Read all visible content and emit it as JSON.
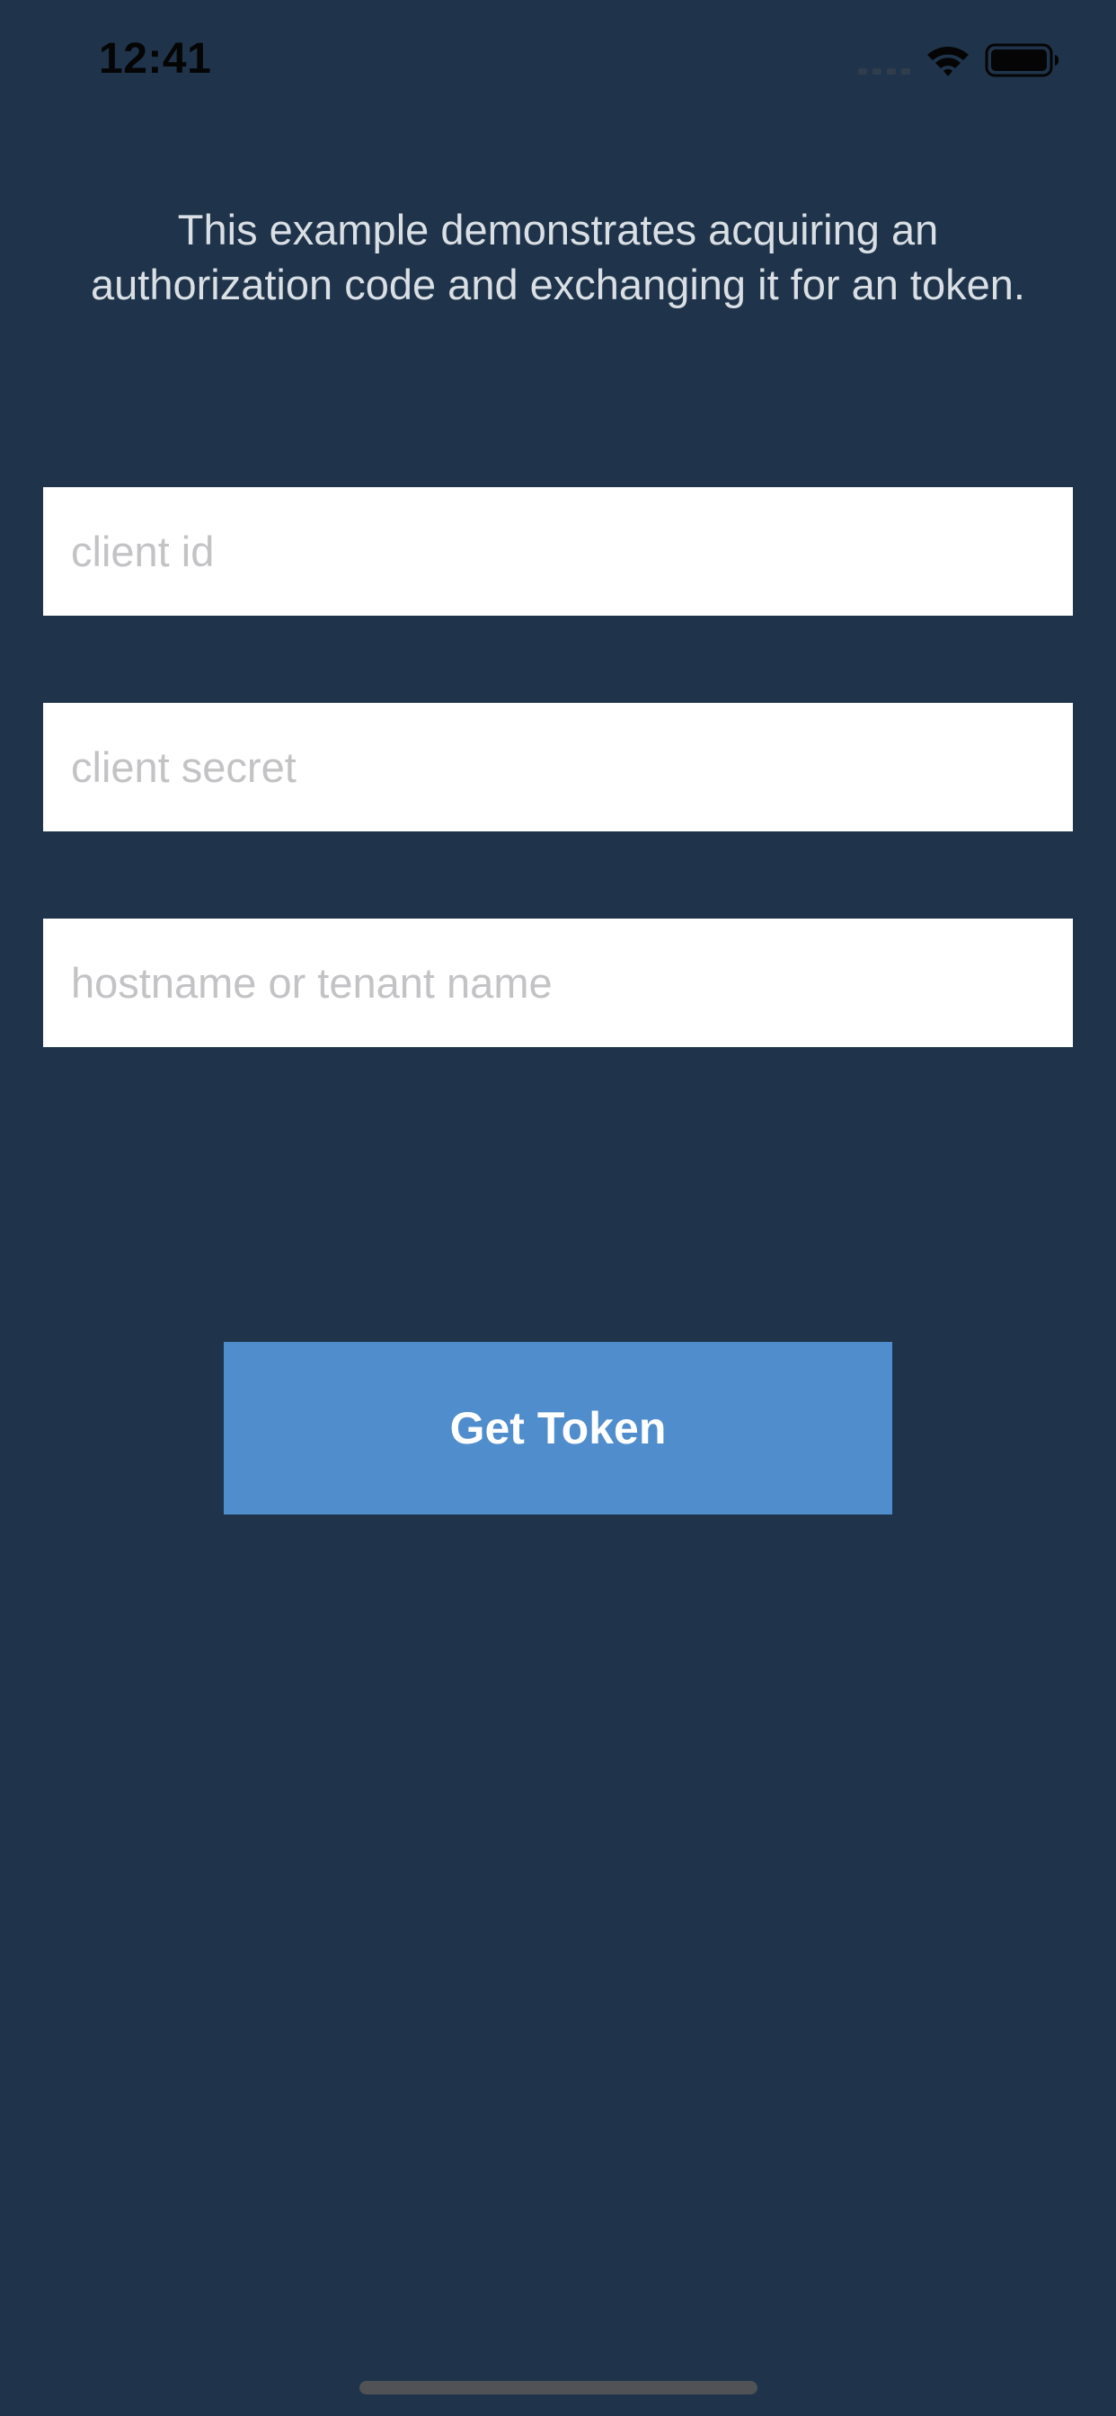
{
  "status_bar": {
    "time": "12:41",
    "icons": [
      "signal-icon",
      "wifi-icon",
      "battery-icon"
    ]
  },
  "description": "This example demonstrates acquiring an\nauthorization code and exchanging it for an token.",
  "form": {
    "client_id": {
      "placeholder": "client id",
      "value": ""
    },
    "client_secret": {
      "placeholder": "client secret",
      "value": ""
    },
    "hostname": {
      "placeholder": "hostname or tenant name",
      "value": ""
    }
  },
  "get_token_button": {
    "label": "Get Token"
  },
  "colors": {
    "background": "#1f344a",
    "button": "#508dcc",
    "text": "#d9dfe5",
    "placeholder": "#c3c3c6"
  }
}
